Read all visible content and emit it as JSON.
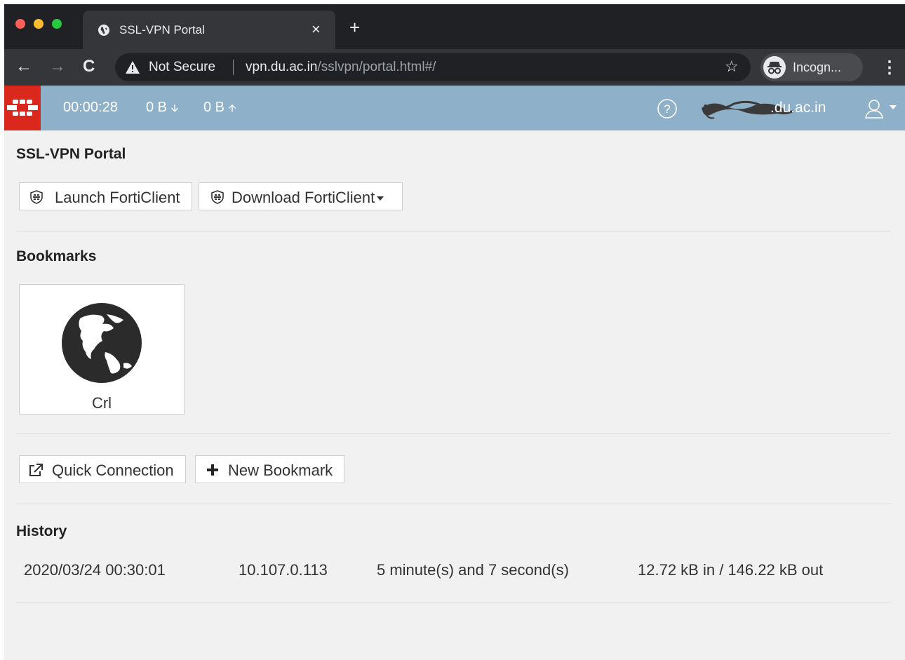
{
  "browser": {
    "tab_title": "SSL-VPN Portal",
    "tab_close": "×",
    "new_tab": "+",
    "back": "←",
    "forward": "→",
    "reload": "C",
    "security_label": "Not Secure",
    "url_host": "vpn.du.ac.in",
    "url_path": "/sslvpn/portal.html#/",
    "bookmark_star": "☆",
    "profile_label": "Incogn...",
    "menu": "⋮",
    "colors": {
      "close": "#ff5f57",
      "minimize": "#febc2e",
      "zoom": "#28c840",
      "tabstrip": "#202124",
      "toolbar": "#35363a"
    }
  },
  "header": {
    "session_time": "00:00:28",
    "bytes_received": "0 B",
    "received_arrow": "🡫",
    "bytes_sent": "0 B",
    "sent_arrow": "🡩",
    "help": "?",
    "user_visible": ".du.ac.in",
    "colors": {
      "bar": "#8eb0c8",
      "logo_bg": "#da291c"
    }
  },
  "portal": {
    "title": "SSL-VPN Portal",
    "launch_forticlient": "Launch FortiClient",
    "download_forticlient": "Download FortiClient"
  },
  "bookmarks": {
    "title": "Bookmarks",
    "items": [
      {
        "label": "Crl",
        "icon": "globe-icon"
      }
    ],
    "quick_connection": "Quick Connection",
    "new_bookmark": "New Bookmark"
  },
  "history": {
    "title": "History",
    "rows": [
      {
        "time": "2020/03/24 00:30:01",
        "ip": "10.107.0.113",
        "duration": "5 minute(s) and 7 second(s)",
        "traffic": "12.72 kB in / 146.22 kB out"
      }
    ]
  }
}
